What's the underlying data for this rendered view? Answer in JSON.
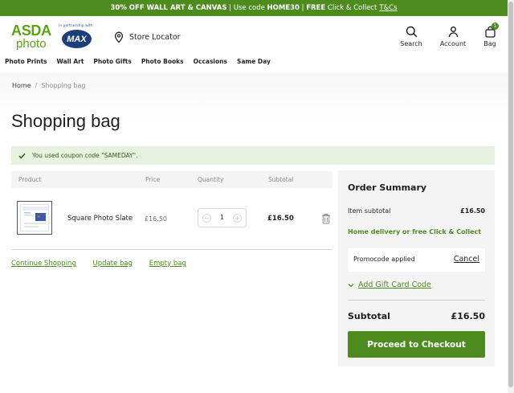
{
  "promo": {
    "offer": "30% OFF WALL ART & CANVAS",
    "code_text": "| Use code",
    "code": "HOME30",
    "sep": "|",
    "free": "FREE",
    "collect": "Click & Collect",
    "terms": "T&Cs"
  },
  "header": {
    "logo_top": "ASDA",
    "logo_bottom": "photo",
    "partner_text": "In partnership with",
    "partner_logo": "MAX",
    "store_locator": "Store Locator",
    "search_label": "Search",
    "account_label": "Account",
    "bag_label": "Bag",
    "bag_count": "1"
  },
  "nav": {
    "items": [
      "Photo Prints",
      "Wall Art",
      "Photo Gifts",
      "Photo Books",
      "Occasions",
      "Same Day"
    ]
  },
  "breadcrumb": {
    "home": "Home",
    "sep": "/",
    "current": "Shopping bag"
  },
  "page_title": "Shopping bag",
  "coupon_message": "You used coupon code \"SAMEDAY\".",
  "cart": {
    "headers": {
      "product": "Product",
      "price": "Price",
      "quantity": "Quantity",
      "subtotal": "Subtotal"
    },
    "items": [
      {
        "name": "Square Photo Slate",
        "price": "£16.50",
        "quantity": "1",
        "subtotal": "£16.50"
      }
    ],
    "links": {
      "continue": "Continue Shopping",
      "update": "Update bag",
      "empty": "Empty bag"
    }
  },
  "summary": {
    "title": "Order Summary",
    "item_subtotal_label": "Item subtotal",
    "item_subtotal_value": "£16.50",
    "delivery_text": "Home delivery or free Click & Collect",
    "promo_applied": "Promocode applied",
    "cancel": "Cancel",
    "gift_card": "Add Gift Card Code",
    "subtotal_label": "Subtotal",
    "subtotal_value": "£16.50",
    "checkout": "Proceed to Checkout"
  },
  "colors": {
    "brand_green": "#4d8b1f",
    "logo_green": "#5ba313",
    "coupon_bg": "#e8f2e1",
    "max_blue": "#1c3f7a"
  }
}
